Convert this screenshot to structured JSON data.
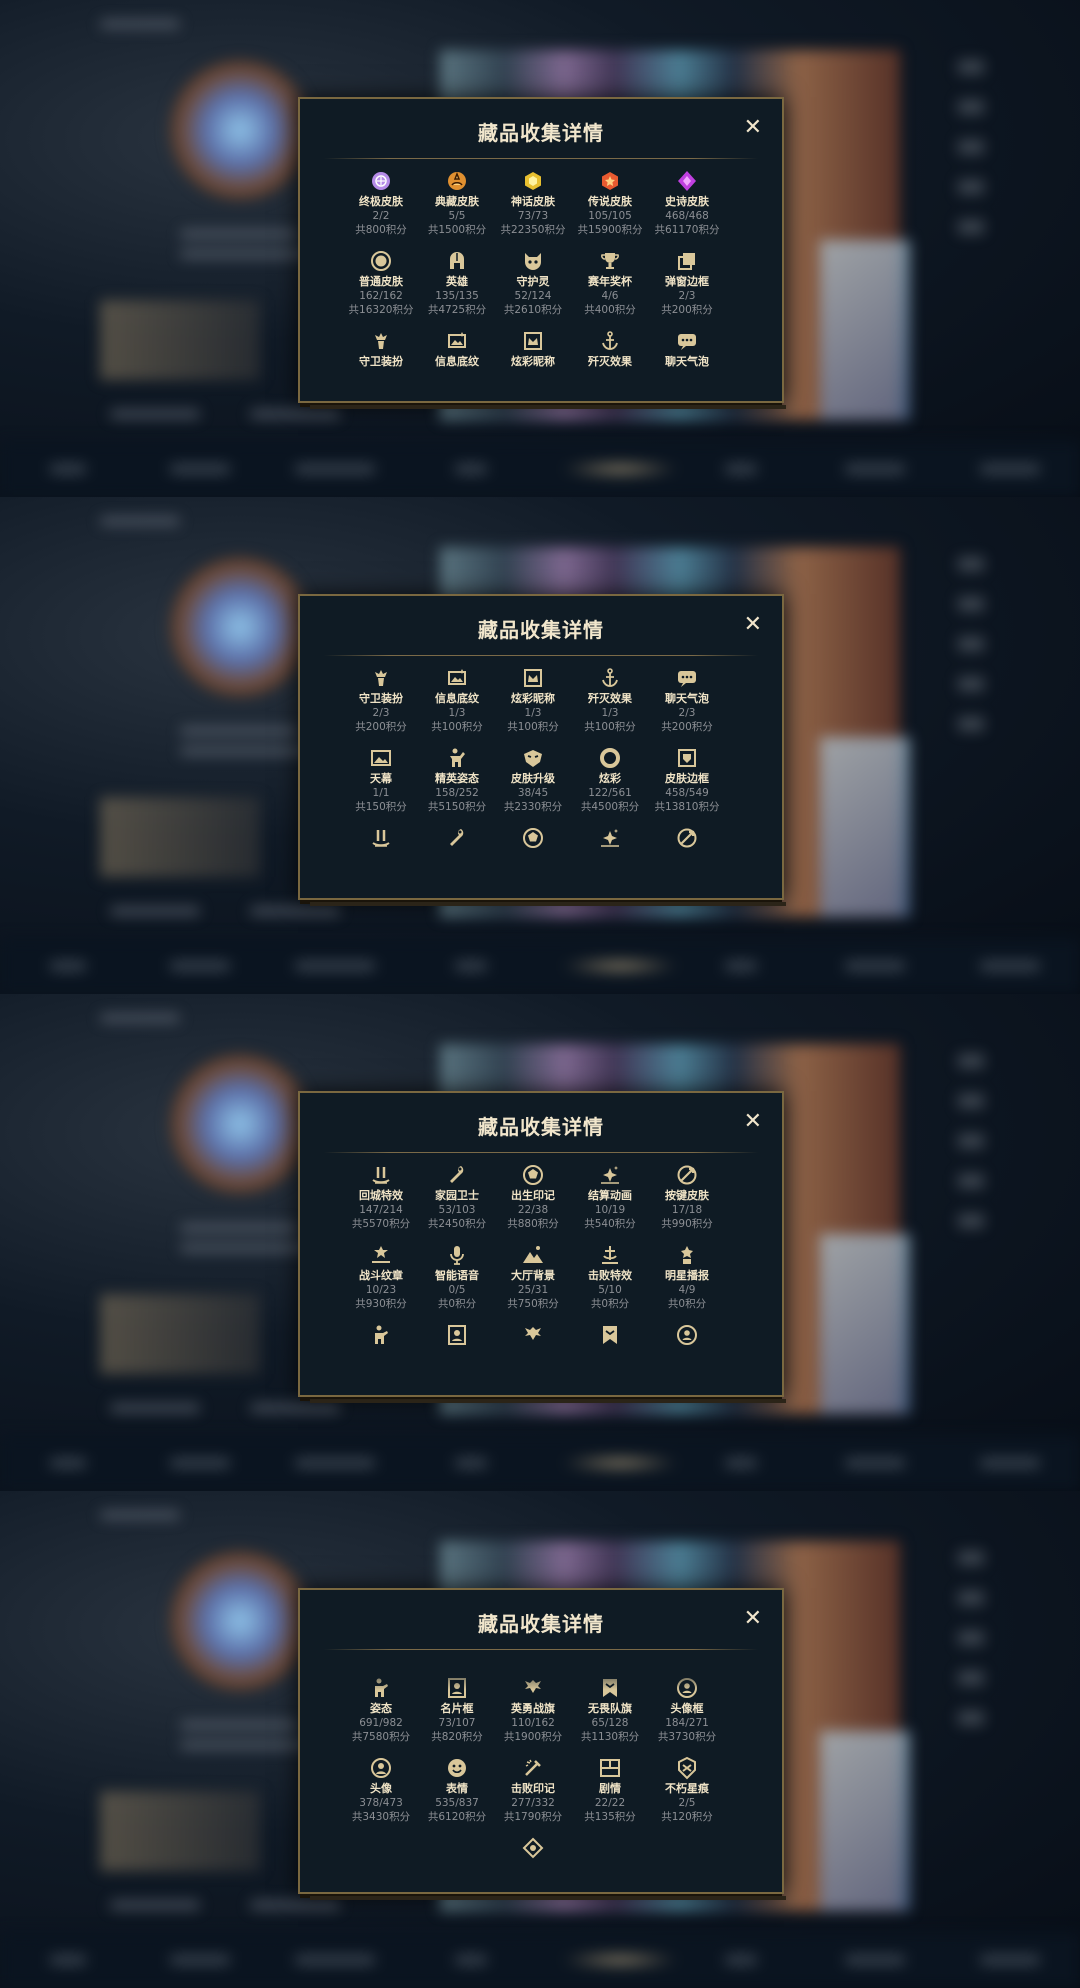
{
  "modal": {
    "title": "藏品收集详情",
    "close_label": "✕"
  },
  "panels": [
    {
      "items": [
        {
          "icon": "ultimate-skin-icon",
          "name": "终极皮肤",
          "count": "2/2",
          "points": "共800积分",
          "tint": "#b58be8"
        },
        {
          "icon": "prestige-skin-icon",
          "name": "典藏皮肤",
          "count": "5/5",
          "points": "共1500积分",
          "tint": "#e09030"
        },
        {
          "icon": "mythic-skin-icon",
          "name": "神话皮肤",
          "count": "73/73",
          "points": "共22350积分",
          "tint": "#e8c030"
        },
        {
          "icon": "legendary-skin-icon",
          "name": "传说皮肤",
          "count": "105/105",
          "points": "共15900积分",
          "tint": "#e85a30"
        },
        {
          "icon": "epic-skin-icon",
          "name": "史诗皮肤",
          "count": "468/468",
          "points": "共61170积分",
          "tint": "#c040e0"
        },
        {
          "icon": "normal-skin-icon",
          "name": "普通皮肤",
          "count": "162/162",
          "points": "共16320积分",
          "tint": "#d9c79a"
        },
        {
          "icon": "champion-helmet-icon",
          "name": "英雄",
          "count": "135/135",
          "points": "共4725积分",
          "tint": "#d9c79a"
        },
        {
          "icon": "ward-guardian-icon",
          "name": "守护灵",
          "count": "52/124",
          "points": "共2610积分",
          "tint": "#d9c79a"
        },
        {
          "icon": "trophy-icon",
          "name": "赛年奖杯",
          "count": "4/6",
          "points": "共400积分",
          "tint": "#d9c79a"
        },
        {
          "icon": "border-frame-icon",
          "name": "弹窗边框",
          "count": "2/3",
          "points": "共200积分",
          "tint": "#d9c79a"
        },
        {
          "icon": "guardian-outfit-icon",
          "name": "守卫装扮",
          "count": "",
          "points": "",
          "tint": "#d9c79a"
        },
        {
          "icon": "info-banner-icon",
          "name": "信息底纹",
          "count": "",
          "points": "",
          "tint": "#d9c79a"
        },
        {
          "icon": "title-crown-icon",
          "name": "炫彩昵称",
          "count": "",
          "points": "",
          "tint": "#d9c79a"
        },
        {
          "icon": "anchor-icon",
          "name": "歼灭效果",
          "count": "",
          "points": "",
          "tint": "#d9c79a"
        },
        {
          "icon": "chat-bubble-icon",
          "name": "聊天气泡",
          "count": "",
          "points": "",
          "tint": "#d9c79a"
        }
      ],
      "offset": 0
    },
    {
      "items": [
        {
          "icon": "guardian-outfit-icon",
          "name": "守卫装扮",
          "count": "2/3",
          "points": "共200积分",
          "tint": "#d9c79a"
        },
        {
          "icon": "info-banner-icon",
          "name": "信息底纹",
          "count": "1/3",
          "points": "共100积分",
          "tint": "#d9c79a"
        },
        {
          "icon": "title-crown-icon",
          "name": "炫彩昵称",
          "count": "1/3",
          "points": "共100积分",
          "tint": "#d9c79a"
        },
        {
          "icon": "anchor-icon",
          "name": "歼灭效果",
          "count": "1/3",
          "points": "共100积分",
          "tint": "#d9c79a"
        },
        {
          "icon": "chat-bubble-icon",
          "name": "聊天气泡",
          "count": "2/3",
          "points": "共200积分",
          "tint": "#d9c79a"
        },
        {
          "icon": "sky-curtain-icon",
          "name": "天幕",
          "count": "1/1",
          "points": "共150积分",
          "tint": "#d9c79a"
        },
        {
          "icon": "elite-pose-icon",
          "name": "精英姿态",
          "count": "158/252",
          "points": "共5150积分",
          "tint": "#d9c79a"
        },
        {
          "icon": "skin-upgrade-mask-icon",
          "name": "皮肤升级",
          "count": "38/45",
          "points": "共2330积分",
          "tint": "#d9c79a"
        },
        {
          "icon": "chroma-ring-icon",
          "name": "炫彩",
          "count": "122/561",
          "points": "共4500积分",
          "tint": "#d9c79a"
        },
        {
          "icon": "skin-border-icon",
          "name": "皮肤边框",
          "count": "458/549",
          "points": "共13810积分",
          "tint": "#d9c79a"
        },
        {
          "icon": "recall-effect-icon",
          "name": "",
          "count": "",
          "points": "",
          "tint": "#d9c79a"
        },
        {
          "icon": "home-guard-icon",
          "name": "",
          "count": "",
          "points": "",
          "tint": "#d9c79a"
        },
        {
          "icon": "birth-mark-icon",
          "name": "",
          "count": "",
          "points": "",
          "tint": "#d9c79a"
        },
        {
          "icon": "settlement-anim-icon",
          "name": "",
          "count": "",
          "points": "",
          "tint": "#d9c79a"
        },
        {
          "icon": "button-skin-icon",
          "name": "",
          "count": "",
          "points": "",
          "tint": "#d9c79a"
        }
      ],
      "offset": 0
    },
    {
      "items": [
        {
          "icon": "recall-effect-icon",
          "name": "回城特效",
          "count": "147/214",
          "points": "共5570积分",
          "tint": "#d9c79a"
        },
        {
          "icon": "home-guard-icon",
          "name": "家园卫士",
          "count": "53/103",
          "points": "共2450积分",
          "tint": "#d9c79a"
        },
        {
          "icon": "birth-mark-icon",
          "name": "出生印记",
          "count": "22/38",
          "points": "共880积分",
          "tint": "#d9c79a"
        },
        {
          "icon": "settlement-anim-icon",
          "name": "结算动画",
          "count": "10/19",
          "points": "共540积分",
          "tint": "#d9c79a"
        },
        {
          "icon": "button-skin-icon",
          "name": "按键皮肤",
          "count": "17/18",
          "points": "共990积分",
          "tint": "#d9c79a"
        },
        {
          "icon": "battle-emblem-icon",
          "name": "战斗纹章",
          "count": "10/23",
          "points": "共930积分",
          "tint": "#d9c79a"
        },
        {
          "icon": "microphone-icon",
          "name": "智能语音",
          "count": "0/5",
          "points": "共0积分",
          "tint": "#d9c79a"
        },
        {
          "icon": "lobby-mountain-icon",
          "name": "大厅背景",
          "count": "25/31",
          "points": "共750积分",
          "tint": "#d9c79a"
        },
        {
          "icon": "kill-effect-icon",
          "name": "击败特效",
          "count": "5/10",
          "points": "共0积分",
          "tint": "#d9c79a"
        },
        {
          "icon": "star-broadcast-icon",
          "name": "明星播报",
          "count": "4/9",
          "points": "共0积分",
          "tint": "#d9c79a"
        },
        {
          "icon": "pose-icon",
          "name": "",
          "count": "",
          "points": "",
          "tint": "#d9c79a"
        },
        {
          "icon": "name-card-icon",
          "name": "",
          "count": "",
          "points": "",
          "tint": "#d9c79a"
        },
        {
          "icon": "hero-banner-icon",
          "name": "",
          "count": "",
          "points": "",
          "tint": "#d9c79a"
        },
        {
          "icon": "team-flag-icon",
          "name": "",
          "count": "",
          "points": "",
          "tint": "#d9c79a"
        },
        {
          "icon": "avatar-frame-icon",
          "name": "",
          "count": "",
          "points": "",
          "tint": "#d9c79a"
        }
      ],
      "offset": 0
    },
    {
      "items": [
        {
          "icon": "pose-icon",
          "name": "姿态",
          "count": "691/982",
          "points": "共7580积分",
          "tint": "#d9c79a"
        },
        {
          "icon": "name-card-icon",
          "name": "名片框",
          "count": "73/107",
          "points": "共820积分",
          "tint": "#d9c79a"
        },
        {
          "icon": "hero-banner-icon",
          "name": "英勇战旗",
          "count": "110/162",
          "points": "共1900积分",
          "tint": "#d9c79a"
        },
        {
          "icon": "team-flag-icon",
          "name": "无畏队旗",
          "count": "65/128",
          "points": "共1130积分",
          "tint": "#d9c79a"
        },
        {
          "icon": "avatar-frame-icon",
          "name": "头像框",
          "count": "184/271",
          "points": "共3730积分",
          "tint": "#d9c79a"
        },
        {
          "icon": "avatar-icon",
          "name": "头像",
          "count": "378/473",
          "points": "共3430积分",
          "tint": "#d9c79a"
        },
        {
          "icon": "emoji-icon",
          "name": "表情",
          "count": "535/837",
          "points": "共6120积分",
          "tint": "#d9c79a"
        },
        {
          "icon": "defeat-mark-icon",
          "name": "击败印记",
          "count": "277/332",
          "points": "共1790积分",
          "tint": "#d9c79a"
        },
        {
          "icon": "story-book-icon",
          "name": "剧情",
          "count": "22/22",
          "points": "共135积分",
          "tint": "#d9c79a"
        },
        {
          "icon": "immortal-star-icon",
          "name": "不朽星痕",
          "count": "2/5",
          "points": "共120积分",
          "tint": "#d9c79a"
        },
        {
          "icon": "diamond-badge-icon",
          "name": "",
          "count": "",
          "points": "",
          "tint": "#d9c79a"
        }
      ],
      "offset": 1
    }
  ]
}
